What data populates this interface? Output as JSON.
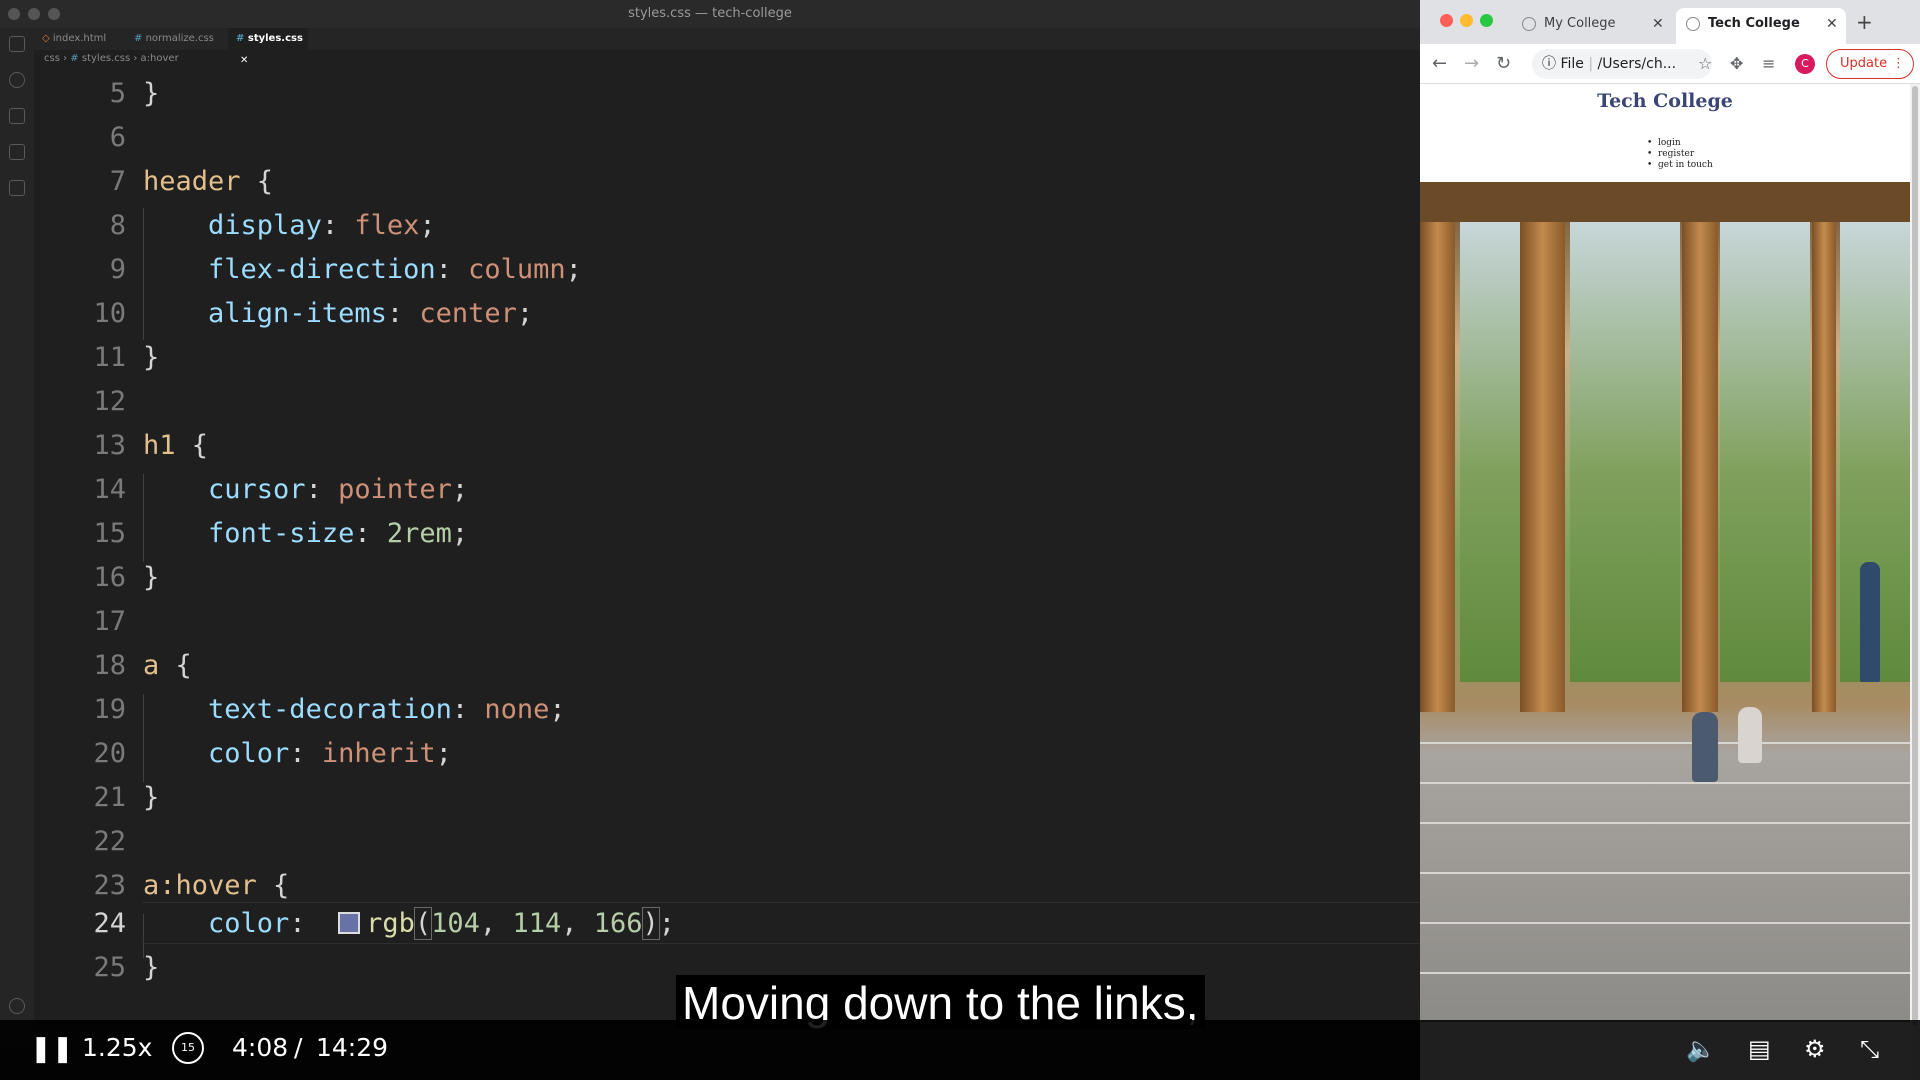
{
  "editor": {
    "title": "styles.css — tech-college",
    "tabs": [
      {
        "label": "index.html",
        "icon": "html-file-icon"
      },
      {
        "label": "normalize.css",
        "icon": "css-file-icon"
      },
      {
        "label": "styles.css",
        "icon": "css-file-icon",
        "active": true
      }
    ],
    "breadcrumb": [
      "css",
      "styles.css",
      "a:hover"
    ],
    "lines": [
      {
        "n": "5"
      },
      {
        "n": "6"
      },
      {
        "n": "7"
      },
      {
        "n": "8"
      },
      {
        "n": "9"
      },
      {
        "n": "10"
      },
      {
        "n": "11"
      },
      {
        "n": "12"
      },
      {
        "n": "13"
      },
      {
        "n": "14"
      },
      {
        "n": "15"
      },
      {
        "n": "16"
      },
      {
        "n": "17"
      },
      {
        "n": "18"
      },
      {
        "n": "19"
      },
      {
        "n": "20"
      },
      {
        "n": "21"
      },
      {
        "n": "22"
      },
      {
        "n": "23"
      },
      {
        "n": "24"
      },
      {
        "n": "25"
      }
    ],
    "code": {
      "l5": "}",
      "l7_sel": "header",
      "l8_prop": "display",
      "l8_val": "flex",
      "l9_prop": "flex-direction",
      "l9_val": "column",
      "l10_prop": "align-items",
      "l10_val": "center",
      "l13_sel": "h1",
      "l14_prop": "cursor",
      "l14_val": "pointer",
      "l15_prop": "font-size",
      "l15_val": "2rem",
      "l18_sel": "a",
      "l19_prop": "text-decoration",
      "l19_val": "none",
      "l20_prop": "color",
      "l20_val": "inherit",
      "l23_sel": "a:hover",
      "l24_prop": "color",
      "l24_fn": "rgb",
      "l24_args": [
        "104",
        "114",
        "166"
      ]
    },
    "swatch_color": "#6872a6"
  },
  "browser": {
    "tabs": [
      {
        "label": "My College"
      },
      {
        "label": "Tech College",
        "active": true
      }
    ],
    "omnibox": {
      "scheme": "File",
      "path": "/Users/ch..."
    },
    "avatar_letter": "C",
    "update_label": "Update",
    "page": {
      "title": "Tech College",
      "nav": [
        "login",
        "register",
        "get in touch"
      ]
    }
  },
  "player": {
    "speed": "1.25x",
    "current_time": "4:08",
    "separator": "/",
    "duration": "14:29",
    "caption": "Moving down to the links,",
    "skip_back": "15"
  }
}
